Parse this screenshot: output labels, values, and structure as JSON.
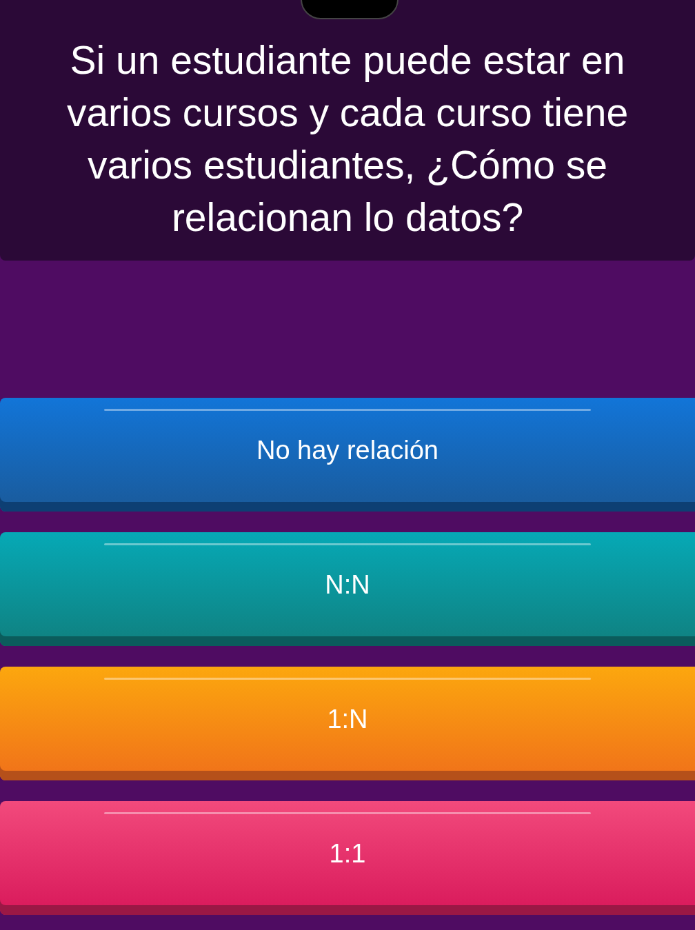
{
  "question": {
    "text": "Si un estudiante puede estar en varios cursos y cada curso tiene varios estudiantes, ¿Cómo se relacionan lo datos?"
  },
  "options": [
    {
      "label": "No hay relación",
      "color": "#1275d8"
    },
    {
      "label": "N:N",
      "color": "#06a9b6"
    },
    {
      "label": "1:N",
      "color": "#fca70e"
    },
    {
      "label": "1:1",
      "color": "#f24a7c"
    }
  ]
}
